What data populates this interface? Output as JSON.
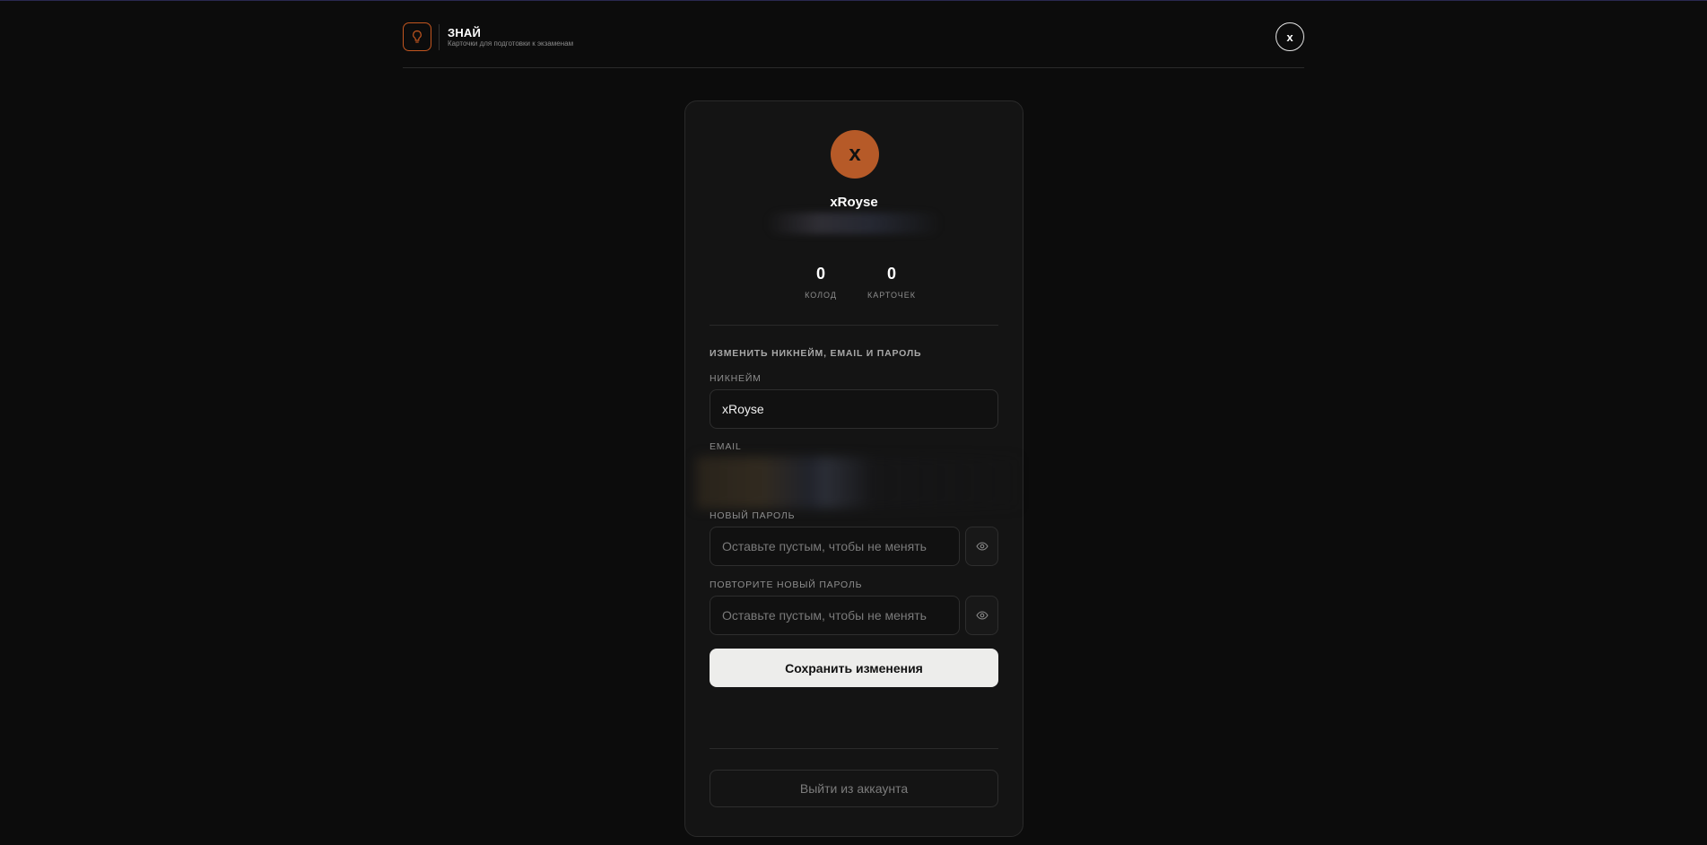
{
  "header": {
    "brand_title": "ЗНАЙ",
    "brand_subtitle": "Карточки для подготовки к экзаменам",
    "logo_icon": "lightbulb-icon",
    "user_initial": "x",
    "accent_color": "#c2561f"
  },
  "profile": {
    "avatar_letter": "x",
    "avatar_color": "#b65a28",
    "username": "xRoyse",
    "stats": [
      {
        "value": "0",
        "label": "КОЛОД"
      },
      {
        "value": "0",
        "label": "КАРТОЧЕК"
      }
    ]
  },
  "form": {
    "section_title": "ИЗМЕНИТЬ НИКНЕЙМ, EMAIL И ПАРОЛЬ",
    "nickname_label": "НИКНЕЙМ",
    "nickname_value": "xRoyse",
    "email_label": "EMAIL",
    "new_password_label": "НОВЫЙ ПАРОЛЬ",
    "new_password_placeholder": "Оставьте пустым, чтобы не менять",
    "repeat_password_label": "ПОВТОРИТЕ НОВЫЙ ПАРОЛЬ",
    "repeat_password_placeholder": "Оставьте пустым, чтобы не менять",
    "toggle_icon": "eye-icon",
    "save_label": "Сохранить изменения"
  },
  "logout_label": "Выйти из аккаунта"
}
